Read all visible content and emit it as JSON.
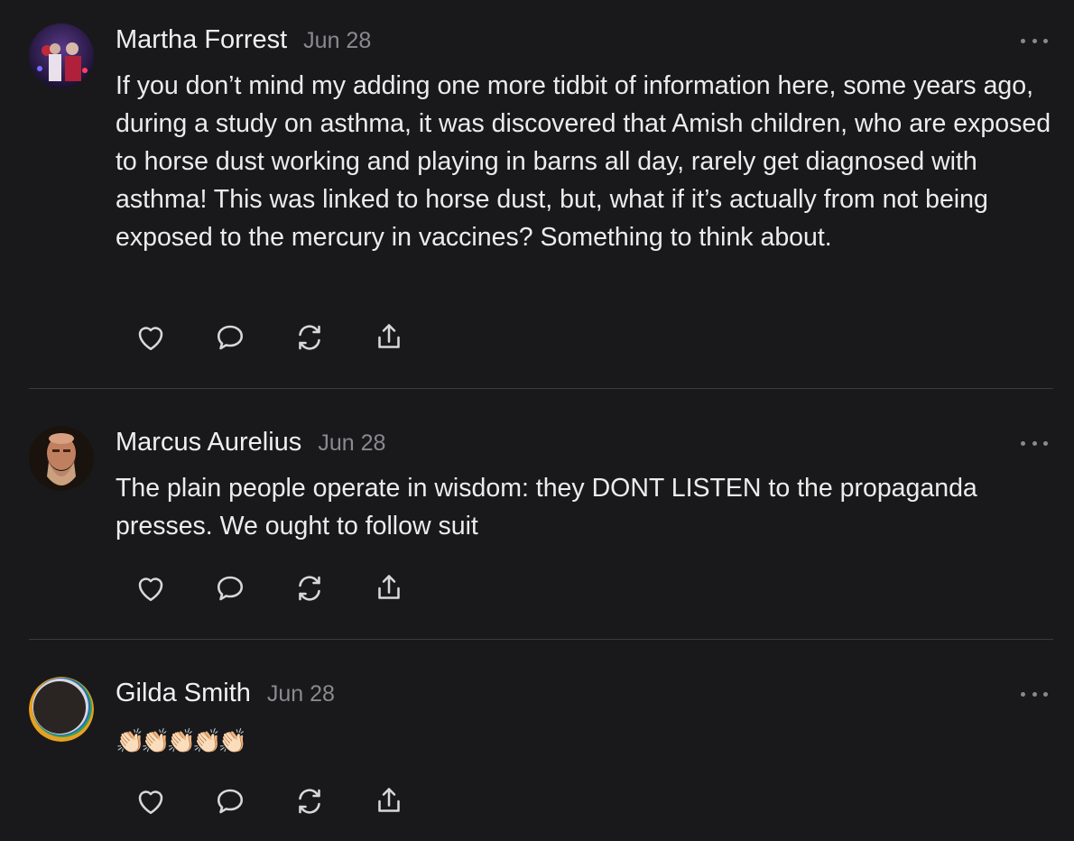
{
  "posts": [
    {
      "author": "Martha Forrest",
      "date": "Jun 28",
      "avatar_icon": "portrait-photo",
      "body": "If you don’t mind my adding one more tidbit of information here, some years ago, during a study on asthma, it was discovered that Amish children, who are exposed to horse dust working and playing in barns all day, rarely get diagnosed with asthma! This was linked to horse dust, but, what if it’s actually from not being exposed to the mercury in vaccines? Something to think about."
    },
    {
      "author": "Marcus Aurelius",
      "date": "Jun 28",
      "avatar_icon": "bearded-man-photo",
      "body": "The plain people operate in wisdom: they DONT LISTEN to the propaganda presses. We ought to follow suit"
    },
    {
      "author": "Gilda Smith",
      "date": "Jun 28",
      "avatar_icon": "ring-avatar",
      "body": "👏🏻👏🏻👏🏻👏🏻👏🏻"
    }
  ],
  "actions": [
    "like-icon",
    "reply-icon",
    "restack-icon",
    "share-icon"
  ],
  "colors": {
    "background": "#19191b",
    "text": "#ececec",
    "muted": "#8a8a8e",
    "divider": "#3a3a3d"
  }
}
